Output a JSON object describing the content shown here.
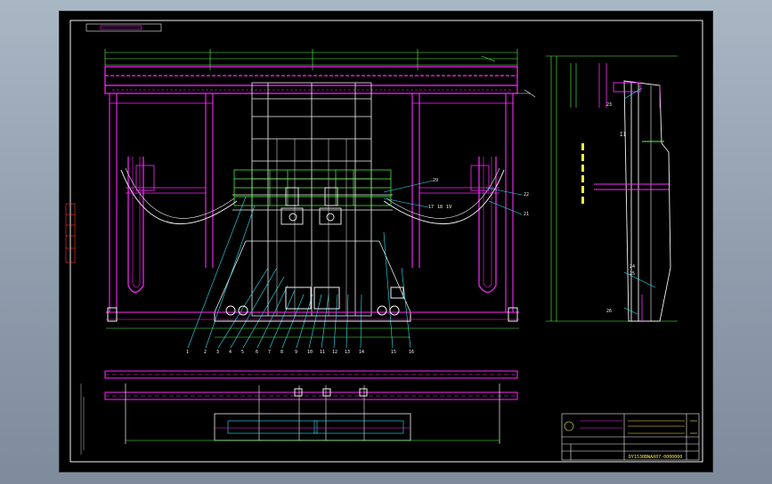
{
  "drawing": {
    "stamp_text": "",
    "callouts_main": [
      "1",
      "2",
      "3",
      "4",
      "5",
      "6",
      "7",
      "8",
      "9",
      "10",
      "11",
      "12",
      "13",
      "14",
      "15",
      "16"
    ],
    "callouts_right": [
      "29",
      "17",
      "18",
      "19",
      "22",
      "21"
    ],
    "callouts_side": [
      "23",
      "24",
      "25",
      "26"
    ],
    "section_mark": "II"
  },
  "title_block": {
    "drawing_number": "DY1530BWAX07-0000000"
  },
  "colors": {
    "magenta": "#ff28ff",
    "white": "#f4f4f4",
    "green": "#5cff4a",
    "cyan": "#2ee6ff",
    "yellow": "#ffe84a",
    "red": "#ff3a3a",
    "blue": "#4b6bff"
  }
}
